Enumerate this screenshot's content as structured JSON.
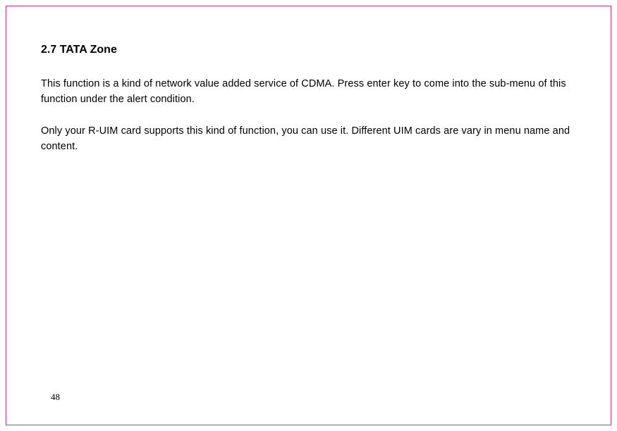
{
  "heading": "2.7 TATA Zone",
  "paragraphs": [
    "This function is a kind of network value added service of CDMA. Press enter key to come into the sub-menu of this function under the alert condition.",
    "Only your R-UIM card supports this kind of function, you can use it. Different UIM cards are vary in menu name and content."
  ],
  "page_number": "48"
}
